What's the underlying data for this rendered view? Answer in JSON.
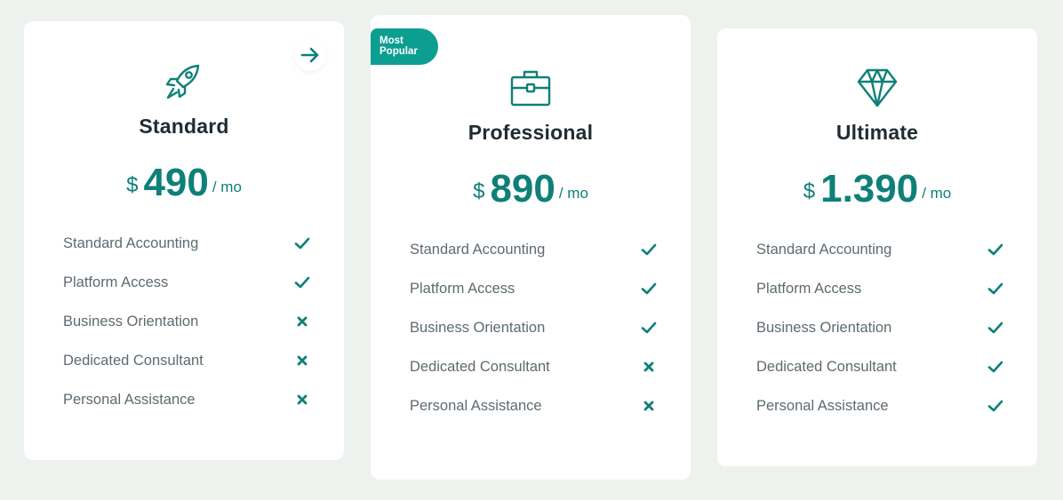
{
  "colors": {
    "background": "#eef2ee",
    "card": "#ffffff",
    "accent": "#0e8078",
    "badge": "#0d9e92",
    "title": "#1f2c33",
    "feature_text": "#5d6b70"
  },
  "plans": [
    {
      "name": "Standard",
      "icon": "rocket-icon",
      "currency": "$",
      "amount": "490",
      "period": "/ mo",
      "action_icon": "arrow-right-icon",
      "features": [
        {
          "label": "Standard Accounting",
          "included": true
        },
        {
          "label": "Platform Access",
          "included": true
        },
        {
          "label": "Business Orientation",
          "included": false
        },
        {
          "label": "Dedicated Consultant",
          "included": false
        },
        {
          "label": "Personal Assistance",
          "included": false
        }
      ]
    },
    {
      "name": "Professional",
      "icon": "briefcase-icon",
      "badge": "Most Popular",
      "badge_line1": "Most",
      "badge_line2": "Popular",
      "currency": "$",
      "amount": "890",
      "period": "/ mo",
      "features": [
        {
          "label": "Standard Accounting",
          "included": true
        },
        {
          "label": "Platform Access",
          "included": true
        },
        {
          "label": "Business Orientation",
          "included": true
        },
        {
          "label": "Dedicated Consultant",
          "included": false
        },
        {
          "label": "Personal Assistance",
          "included": false
        }
      ]
    },
    {
      "name": "Ultimate",
      "icon": "diamond-icon",
      "currency": "$",
      "amount": "1.390",
      "period": "/ mo",
      "features": [
        {
          "label": "Standard Accounting",
          "included": true
        },
        {
          "label": "Platform Access",
          "included": true
        },
        {
          "label": "Business Orientation",
          "included": true
        },
        {
          "label": "Dedicated Consultant",
          "included": true
        },
        {
          "label": "Personal Assistance",
          "included": true
        }
      ]
    }
  ]
}
